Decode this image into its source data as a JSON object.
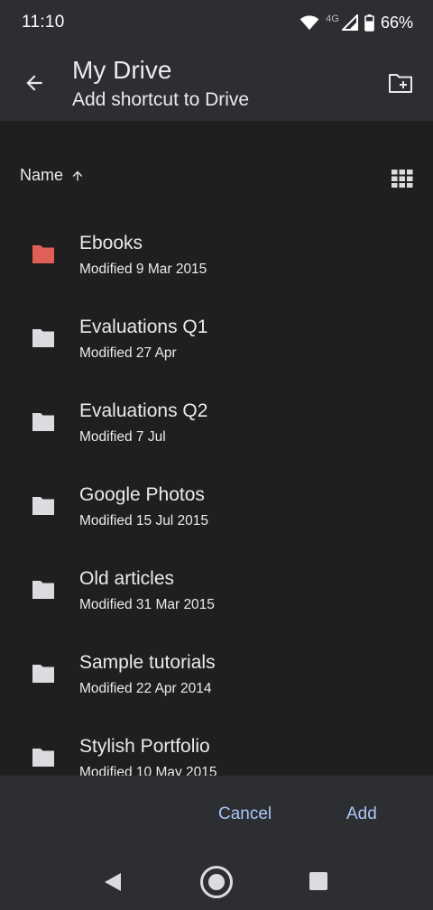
{
  "status_bar": {
    "time": "11:10",
    "network": "4G",
    "battery": "66%"
  },
  "app_bar": {
    "title": "My Drive",
    "subtitle": "Add shortcut to Drive"
  },
  "sort": {
    "label": "Name",
    "direction": "ascending"
  },
  "files": [
    {
      "name": "Ebooks",
      "modified": "Modified 9 Mar 2015",
      "color": "#e06055"
    },
    {
      "name": "Evaluations Q1",
      "modified": "Modified 27 Apr",
      "color": "#dadce0"
    },
    {
      "name": "Evaluations Q2",
      "modified": "Modified 7 Jul",
      "color": "#dadce0"
    },
    {
      "name": "Google Photos",
      "modified": "Modified 15 Jul 2015",
      "color": "#dadce0"
    },
    {
      "name": "Old articles",
      "modified": "Modified 31 Mar 2015",
      "color": "#dadce0"
    },
    {
      "name": "Sample tutorials",
      "modified": "Modified 22 Apr 2014",
      "color": "#dadce0"
    },
    {
      "name": "Stylish Portfolio",
      "modified": "Modified 10 May 2015",
      "color": "#dadce0"
    }
  ],
  "actions": {
    "cancel_label": "Cancel",
    "add_label": "Add",
    "accent": "#a8c7fa"
  },
  "theme": {
    "background": "#1f1f1f",
    "surface": "#2d2e31"
  }
}
